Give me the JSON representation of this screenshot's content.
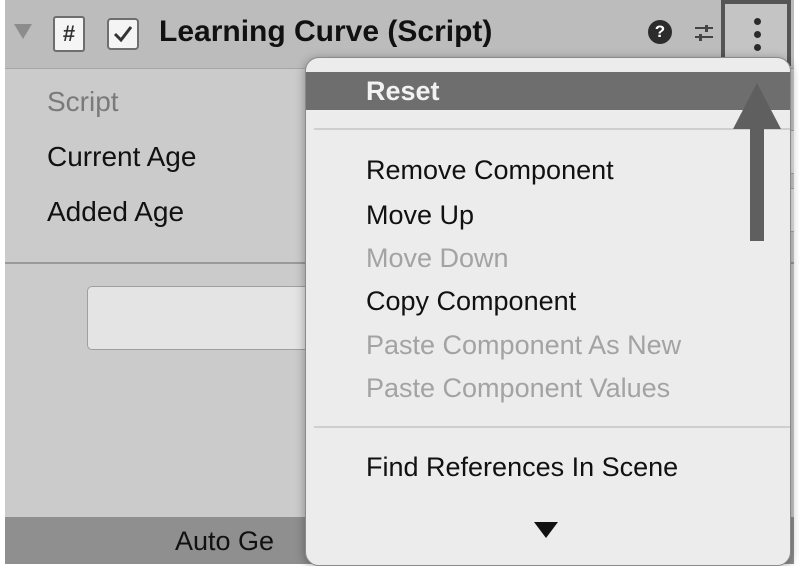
{
  "header": {
    "script_icon_glyph": "#",
    "title": "Learning Curve (Script)",
    "help_glyph": "?"
  },
  "fields": [
    {
      "label": "Script",
      "state": "disabled"
    },
    {
      "label": "Current Age",
      "state": "enabled"
    },
    {
      "label": "Added Age",
      "state": "enabled"
    }
  ],
  "status_bar": {
    "text": "Auto Ge"
  },
  "context_menu": {
    "items": [
      {
        "label": "Reset",
        "state": "highlighted"
      },
      {
        "label": "Remove Component",
        "state": "enabled"
      },
      {
        "label": "Move Up",
        "state": "enabled"
      },
      {
        "label": "Move Down",
        "state": "disabled"
      },
      {
        "label": "Copy Component",
        "state": "enabled"
      },
      {
        "label": "Paste Component As New",
        "state": "disabled"
      },
      {
        "label": "Paste Component Values",
        "state": "disabled"
      },
      {
        "label": "Find References In Scene",
        "state": "enabled"
      }
    ]
  },
  "icons": {
    "foldout": "triangle-down-icon",
    "script": "script-hash-icon",
    "checkbox": "checkmark-icon",
    "help": "help-icon",
    "preset": "preset-sliders-icon",
    "more": "vertical-ellipsis-icon",
    "scroll": "scroll-down-triangle-icon",
    "annotation": "up-arrow-icon"
  },
  "colors": {
    "highlight": "#6e6e6e",
    "menu_bg": "#ececec",
    "disabled_text": "#a3a3a3",
    "annotation_arrow": "#5f5f5f"
  }
}
